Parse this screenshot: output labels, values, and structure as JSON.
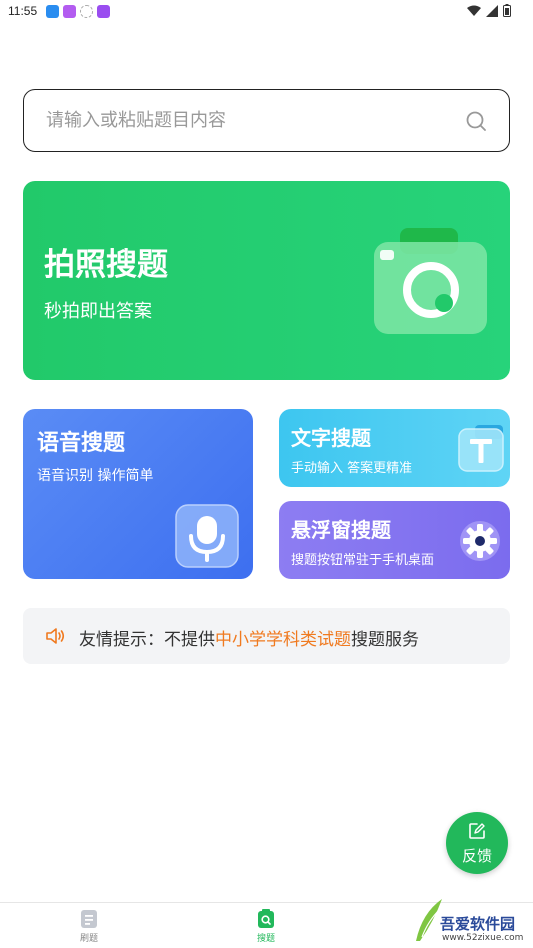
{
  "status_bar": {
    "time": "11:55",
    "icons": [
      "signal-icon",
      "wifi-icon",
      "battery-icon"
    ]
  },
  "search": {
    "placeholder": "请输入或粘贴题目内容",
    "value": ""
  },
  "cards": {
    "photo": {
      "title": "拍照搜题",
      "subtitle": "秒拍即出答案"
    },
    "voice": {
      "title": "语音搜题",
      "subtitle": "语音识别 操作简单"
    },
    "text": {
      "title": "文字搜题",
      "subtitle": "手动输入 答案更精准"
    },
    "float": {
      "title": "悬浮窗搜题",
      "subtitle": "搜题按钮常驻于手机桌面"
    }
  },
  "tip": {
    "prefix": "友情提示：不提供",
    "highlight": "中小学学科类试题",
    "suffix": "搜题服务"
  },
  "feedback": {
    "label": "反馈"
  },
  "nav": {
    "items": [
      {
        "label": "刷题",
        "active": false
      },
      {
        "label": "搜题",
        "active": true
      }
    ]
  },
  "watermark": {
    "name": "吾爱软件园",
    "url": "www.52zixue.com"
  },
  "colors": {
    "primary_green": "#22b85b",
    "tip_highlight": "#f07a20",
    "voice_blue": "#3d6ff0",
    "text_cyan": "#3dc6f0",
    "float_purple": "#7b6cee"
  }
}
